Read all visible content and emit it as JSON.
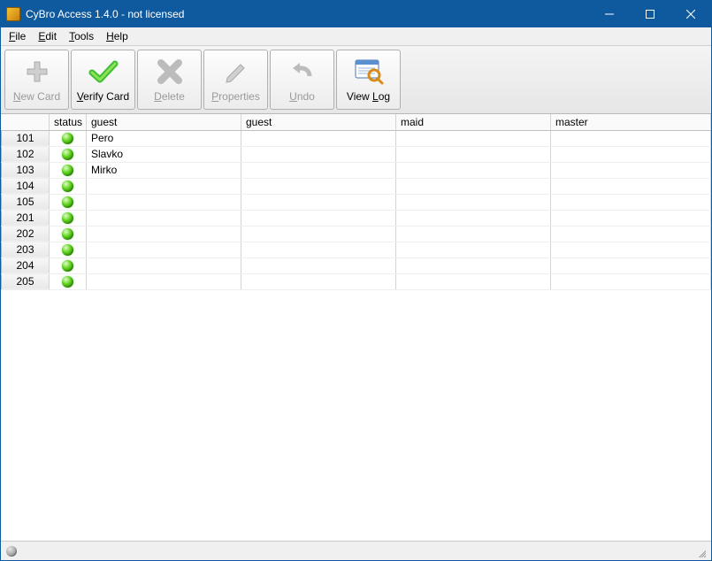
{
  "window": {
    "title": "CyBro Access 1.4.0 - not licensed"
  },
  "menu": {
    "file": "File",
    "edit": "Edit",
    "tools": "Tools",
    "help": "Help"
  },
  "toolbar": {
    "new_card": "New Card",
    "verify_card": "Verify Card",
    "delete": "Delete",
    "properties": "Properties",
    "undo": "Undo",
    "view_log": "View Log"
  },
  "columns": {
    "status": "status",
    "guest1": "guest",
    "guest2": "guest",
    "maid": "maid",
    "master": "master"
  },
  "rows": [
    {
      "id": "101",
      "status": "green",
      "guest1": "Pero",
      "guest2": "",
      "maid": "",
      "master": ""
    },
    {
      "id": "102",
      "status": "green",
      "guest1": "Slavko",
      "guest2": "",
      "maid": "",
      "master": ""
    },
    {
      "id": "103",
      "status": "green",
      "guest1": "Mirko",
      "guest2": "",
      "maid": "",
      "master": ""
    },
    {
      "id": "104",
      "status": "green",
      "guest1": "",
      "guest2": "",
      "maid": "",
      "master": ""
    },
    {
      "id": "105",
      "status": "green",
      "guest1": "",
      "guest2": "",
      "maid": "",
      "master": ""
    },
    {
      "id": "201",
      "status": "green",
      "guest1": "",
      "guest2": "",
      "maid": "",
      "master": ""
    },
    {
      "id": "202",
      "status": "green",
      "guest1": "",
      "guest2": "",
      "maid": "",
      "master": ""
    },
    {
      "id": "203",
      "status": "green",
      "guest1": "",
      "guest2": "",
      "maid": "",
      "master": ""
    },
    {
      "id": "204",
      "status": "green",
      "guest1": "",
      "guest2": "",
      "maid": "",
      "master": ""
    },
    {
      "id": "205",
      "status": "green",
      "guest1": "",
      "guest2": "",
      "maid": "",
      "master": ""
    }
  ]
}
